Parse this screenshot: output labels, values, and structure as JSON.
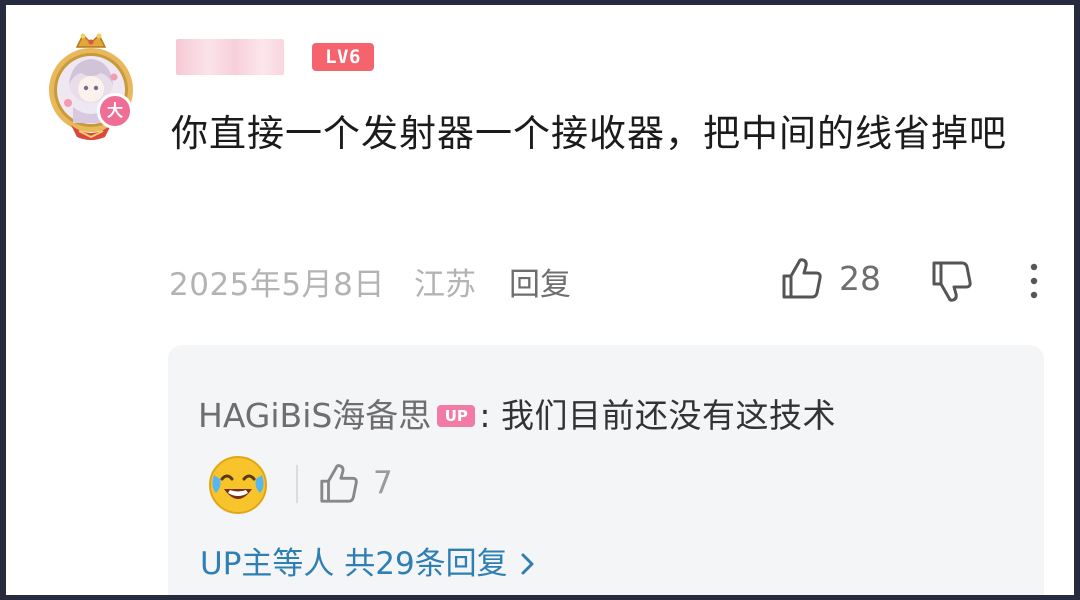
{
  "comment": {
    "level_badge": "LV6",
    "text": "你直接一个发射器一个接收器，把中间的线省掉吧",
    "date": "2025年5月8日",
    "region": "江苏",
    "reply_label": "回复",
    "like_count": "28",
    "avatar_badge": "大"
  },
  "reply": {
    "author": "HAGiBiS海备思",
    "author_badge": "UP",
    "colon": ":",
    "text": "我们目前还没有这技术",
    "like_count": "7",
    "more_replies_label": "UP主等人 共29条回复"
  },
  "icons": {
    "like": "thumbs-up-icon",
    "dislike": "thumbs-down-icon",
    "more": "more-vertical-icon",
    "emoji": "laughing-tears-emoji",
    "chevron": "chevron-right-icon"
  },
  "colors": {
    "level_badge": "#f5646c",
    "up_badge": "#f27ba4",
    "link_blue": "#2e7fb4",
    "reply_bg": "#f4f5f7",
    "frame": "#262c3e"
  }
}
